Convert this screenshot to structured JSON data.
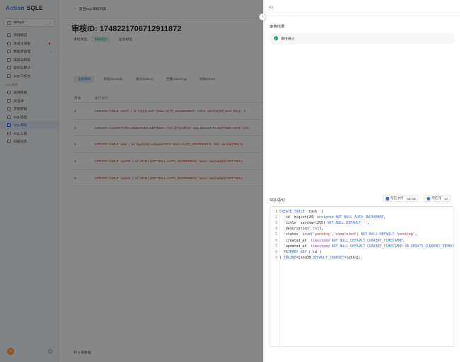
{
  "sidebar": {
    "brand_action": "Action",
    "brand_sqle": "SQLE",
    "project": "default",
    "items": [
      {
        "label": "项目概览",
        "arrow": "",
        "dot": false
      },
      {
        "label": "待关注清单",
        "arrow": "",
        "dot": true
      },
      {
        "label": "数据源管理",
        "arrow": "∨",
        "dot": false
      },
      {
        "label": "成员与权限",
        "arrow": "",
        "dot": false
      },
      {
        "label": "操作与审计",
        "arrow": "",
        "dot": false
      },
      {
        "label": "SQL工作台",
        "arrow": "",
        "dot": false
      }
    ],
    "section": "SQL审核",
    "items2": [
      {
        "label": "规则模板",
        "active": false
      },
      {
        "label": "白名单",
        "active": false
      },
      {
        "label": "流程模板",
        "active": false
      },
      {
        "label": "SQL管控",
        "active": false
      },
      {
        "label": "SQL审核",
        "active": true
      },
      {
        "label": "SQL工单",
        "active": false
      },
      {
        "label": "扫描任务",
        "active": false
      }
    ],
    "avatar": "A"
  },
  "main": {
    "back_label": "返回SQL审核列表",
    "title": "审核ID: 1748221706712911872",
    "status_label": "审核状态:",
    "status_badge": "审核成功",
    "business_label": "业务标签:",
    "business_value": "-",
    "filter_tabs": [
      "全部审核",
      "审核(Normal)",
      "通过(Notice)",
      "告警(Warning)",
      "错误(Error)"
    ],
    "table_headers": {
      "no": "序号",
      "sql": "执行语句"
    },
    "rows": [
      {
        "no": "1",
        "sql": "CREATE TABLE `users` ( `id` int(11) NOT NULL AUTO_INCREMENT, `name` varchar(50) NOT NULL, `e"
      },
      {
        "no": "2",
        "sql": "CREATE ALGORITHM=UNDEFINED DEFINER=`root`@`localhost` SQL SECURITY DEFINER VIEW `user"
      },
      {
        "no": "3",
        "sql": "CREATE TABLE `task` ( `id` bigint(20) unsigned NOT NULL AUTO_INCREMENT, `title` varchar(255) N"
      },
      {
        "no": "4",
        "sql": "CREATE TABLE `users2` ( `id` int(11) NOT NULL AUTO_INCREMENT, `name` varchar(50) NOT NULL,"
      },
      {
        "no": "5",
        "sql": "CREATE TABLE `users1` ( `id` int(11) NOT NULL AUTO_INCREMENT, `name` varchar(50) NOT NULL,"
      }
    ],
    "total": "共 5 条数据"
  },
  "drawer": {
    "header": "#3",
    "result_title": "审核结果",
    "result_text": "审核通过",
    "sql_title": "SQL语句",
    "file_label": "所在文件",
    "file_name": "sql.sql",
    "line_label": "所在行",
    "line_value": "12",
    "code_lines": [
      "CREATE TABLE `task` (",
      "  `id` bigint(20) unsigned NOT NULL AUTO_INCREMENT,",
      "  `title` varchar(255) NOT NULL DEFAULT '',",
      "  `description` text,",
      "  `status` enum('pending','completed') NOT NULL DEFAULT 'pending',",
      "  `created_at` timestamp NOT NULL DEFAULT CURRENT_TIMESTAMP,",
      "  `updated_at` timestamp NOT NULL DEFAULT CURRENT_TIMESTAMP ON UPDATE CURRENT_TIMESTAMP,",
      "  PRIMARY KEY (`id`)",
      ") ENGINE=InnoDB DEFAULT CHARSET=latin1;"
    ]
  },
  "colors": {
    "accent": "#3d6fd1",
    "success": "#2fa36b",
    "danger": "#c0392b"
  }
}
